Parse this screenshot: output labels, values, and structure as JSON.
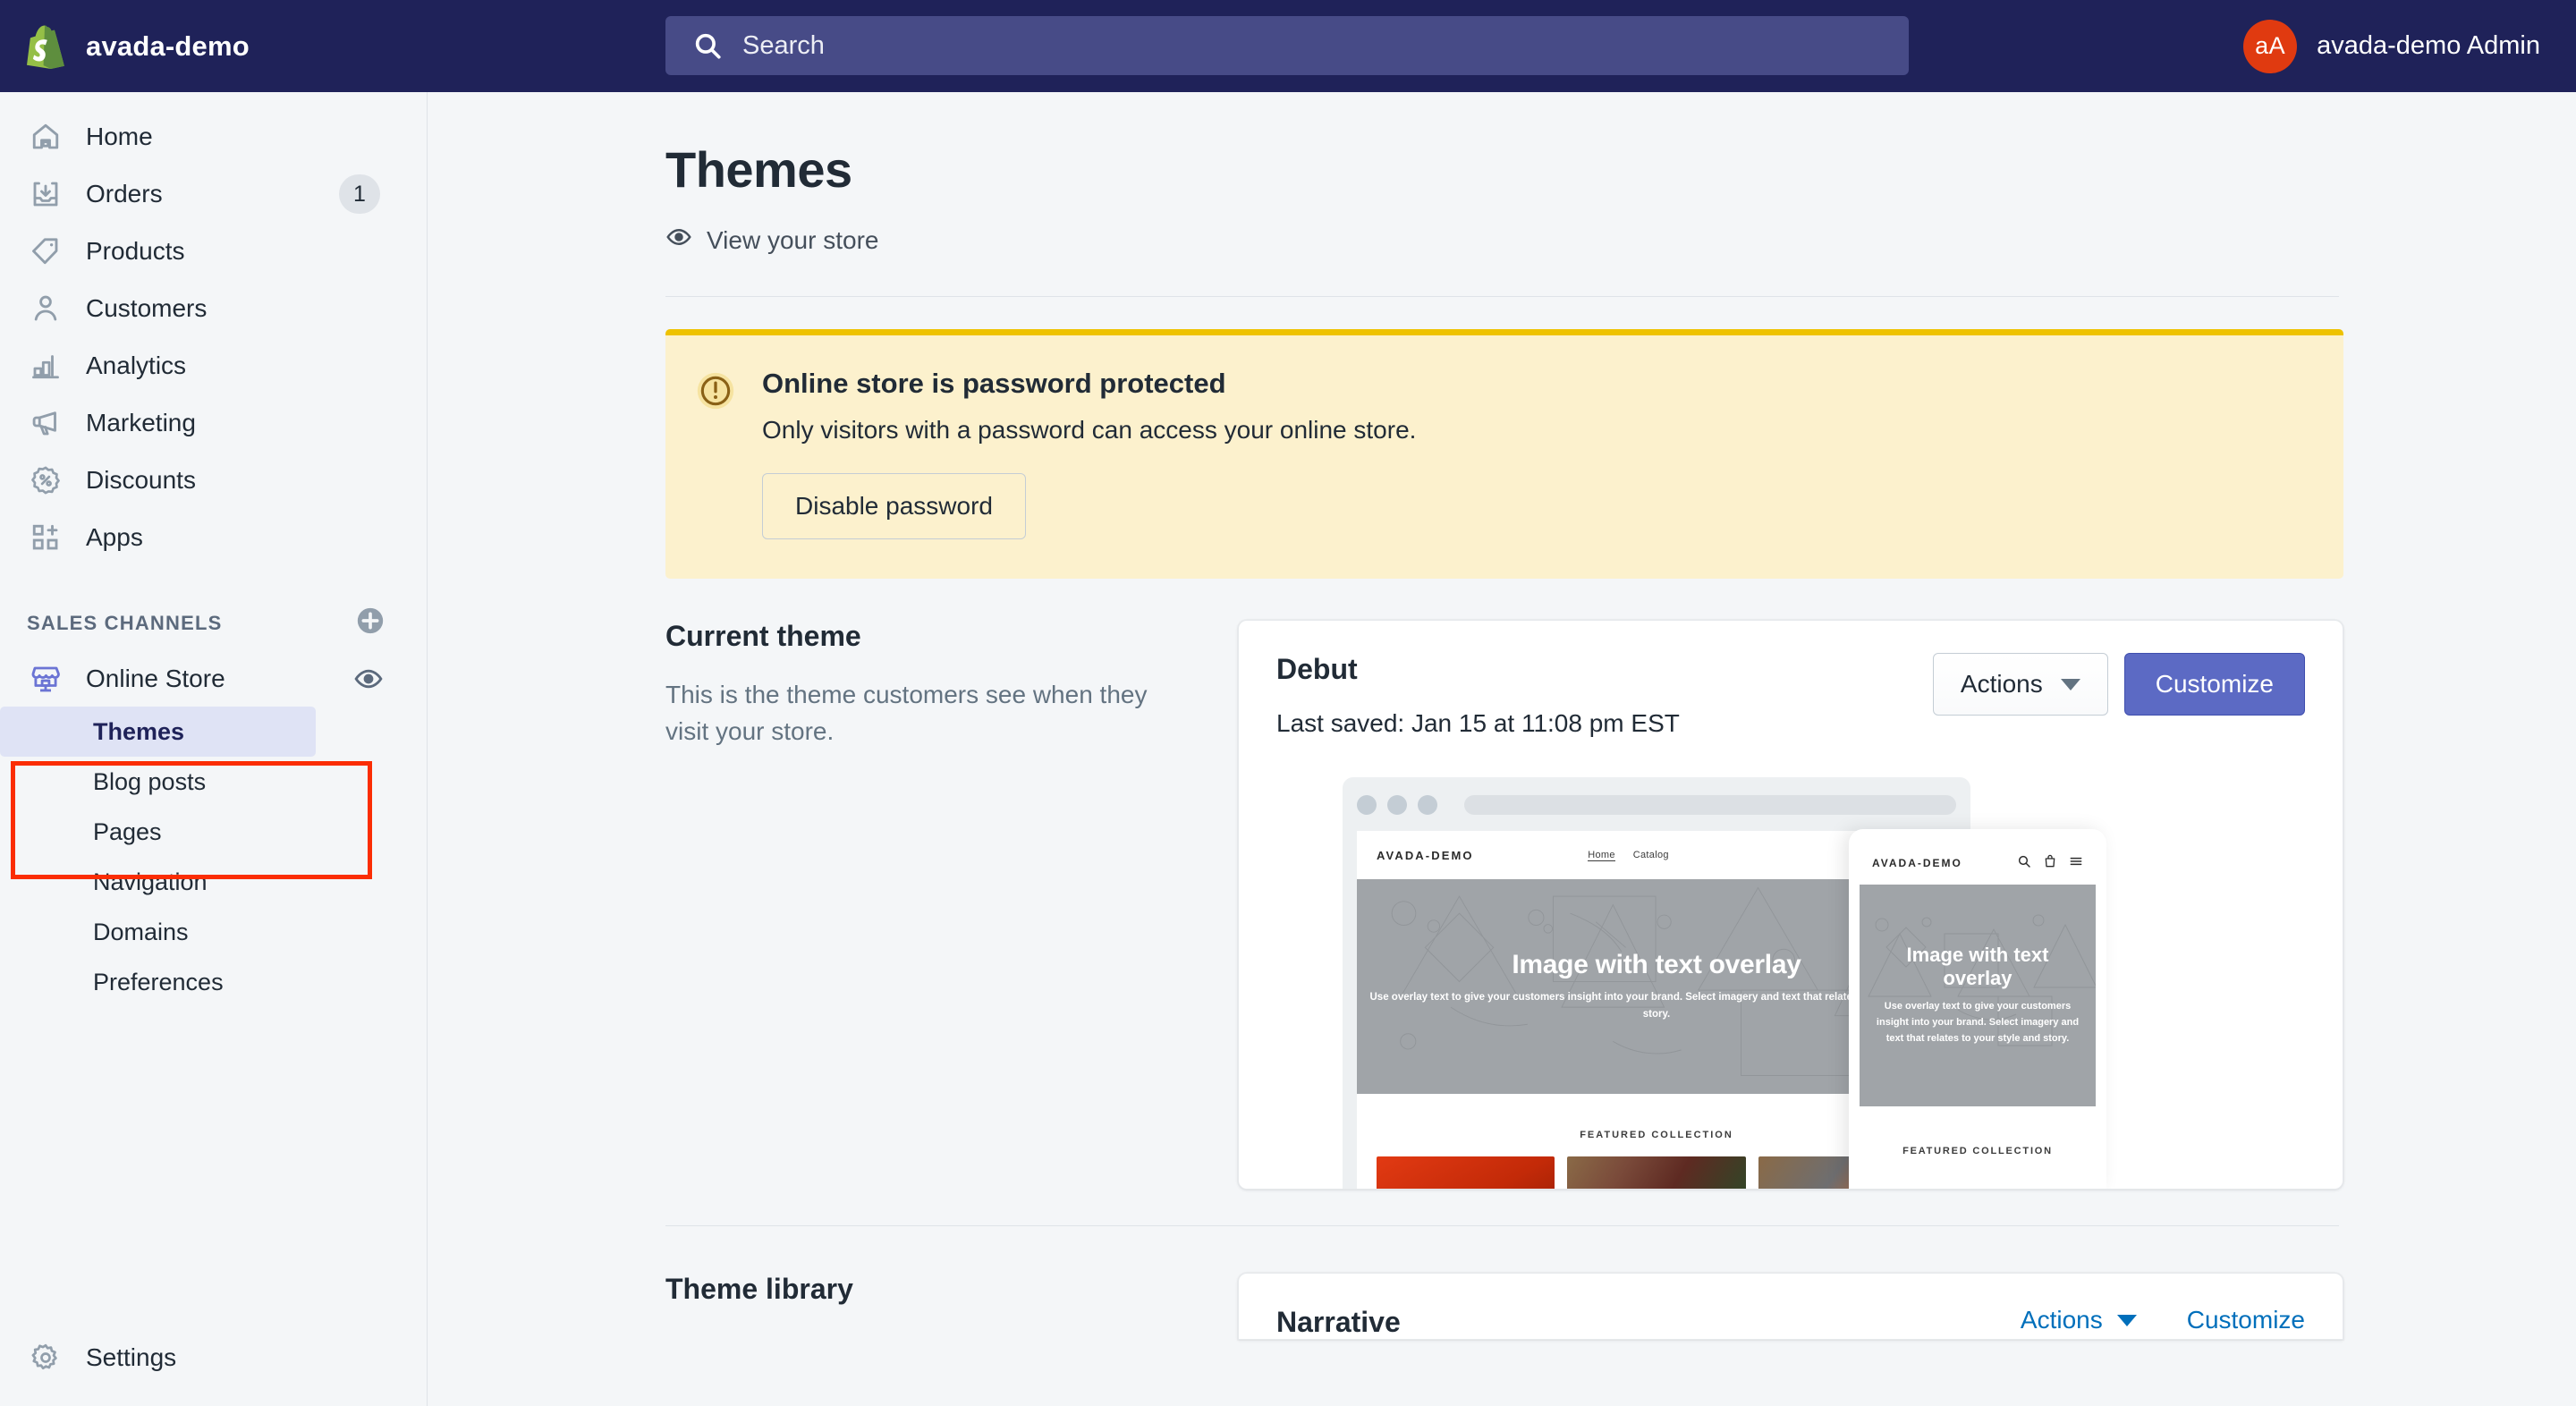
{
  "topbar": {
    "brand_name": "avada-demo",
    "logo_icon": "shopify-bag-icon",
    "search_placeholder": "Search",
    "search_value": "",
    "search_icon": "search-icon",
    "avatar_initials": "aA",
    "avatar_color": "#E03A10",
    "user_name": "avada-demo Admin",
    "background_color": "#1F2259"
  },
  "sidebar": {
    "items": [
      {
        "label": "Home",
        "icon": "home-icon",
        "badge": ""
      },
      {
        "label": "Orders",
        "icon": "orders-inbox-icon",
        "badge": "1"
      },
      {
        "label": "Products",
        "icon": "tag-icon",
        "badge": ""
      },
      {
        "label": "Customers",
        "icon": "person-icon",
        "badge": ""
      },
      {
        "label": "Analytics",
        "icon": "bar-chart-icon",
        "badge": ""
      },
      {
        "label": "Marketing",
        "icon": "megaphone-icon",
        "badge": ""
      },
      {
        "label": "Discounts",
        "icon": "discount-percent-icon",
        "badge": ""
      },
      {
        "label": "Apps",
        "icon": "apps-grid-plus-icon",
        "badge": ""
      }
    ],
    "channels_title": "SALES CHANNELS",
    "add_channel_icon": "plus-circle-icon",
    "online_store": {
      "label": "Online Store",
      "icon": "storefront-icon",
      "icon_color": "#6B74D4",
      "view_icon": "eye-icon"
    },
    "sub_items": [
      {
        "label": "Themes",
        "active": true
      },
      {
        "label": "Blog posts",
        "active": false
      },
      {
        "label": "Pages",
        "active": false
      },
      {
        "label": "Navigation",
        "active": false
      },
      {
        "label": "Domains",
        "active": false
      },
      {
        "label": "Preferences",
        "active": false
      }
    ],
    "settings": {
      "label": "Settings",
      "icon": "gear-icon"
    },
    "highlight_color": "#FB2D04"
  },
  "page": {
    "title": "Themes",
    "view_store_label": "View your store",
    "view_store_icon": "eye-icon"
  },
  "banner": {
    "icon": "exclamation-circle-icon",
    "title": "Online store is password protected",
    "body": "Only visitors with a password can access your online store.",
    "button_label": "Disable password",
    "background_color": "#FCF1CD",
    "border_color": "#EEC200"
  },
  "current_theme": {
    "section_title": "Current theme",
    "section_desc": "This is the theme customers see when they visit your store.",
    "name": "Debut",
    "last_saved": "Last saved: Jan 15 at 11:08 pm EST",
    "actions_label": "Actions",
    "actions_caret_icon": "chevron-down-icon",
    "customize_label": "Customize",
    "customize_color": "#5C6AC4",
    "preview": {
      "desktop": {
        "store_logo": "AVADA-DEMO",
        "nav": [
          "Home",
          "Catalog"
        ],
        "icons": [
          "search-icon",
          "cart-icon"
        ],
        "hero_title": "Image with text overlay",
        "hero_body": "Use overlay text to give your customers insight into your brand. Select imagery and text that relates to your style and story.",
        "featured_title": "FEATURED COLLECTION"
      },
      "mobile": {
        "store_logo": "AVADA-DEMO",
        "icons": [
          "search-icon",
          "cart-icon",
          "hamburger-menu-icon"
        ],
        "hero_title": "Image with text overlay",
        "hero_body": "Use overlay text to give your customers insight into your brand. Select imagery and text that relates to your style and story.",
        "featured_title": "FEATURED COLLECTION"
      }
    }
  },
  "theme_library": {
    "section_title": "Theme library",
    "theme_name": "Narrative",
    "actions_label": "Actions",
    "customize_label": "Customize",
    "link_color": "#006FBB"
  }
}
